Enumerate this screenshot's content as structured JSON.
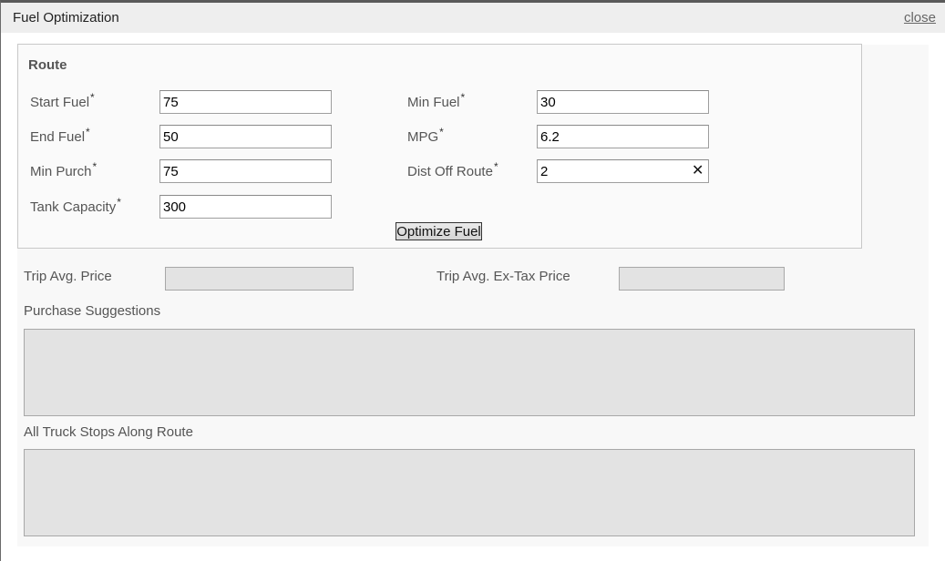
{
  "window": {
    "title": "Fuel Optimization",
    "close_label": "close"
  },
  "route": {
    "heading": "Route",
    "required_marker": "*",
    "fields": {
      "start_fuel": {
        "label": "Start Fuel",
        "value": "75"
      },
      "end_fuel": {
        "label": "End Fuel",
        "value": "50"
      },
      "min_purch": {
        "label": "Min Purch",
        "value": "75"
      },
      "tank_capacity": {
        "label": "Tank Capacity",
        "value": "300"
      },
      "min_fuel": {
        "label": "Min Fuel",
        "value": "30"
      },
      "mpg": {
        "label": "MPG",
        "value": "6.2"
      },
      "dist_off_route": {
        "label": "Dist Off Route",
        "value": "2",
        "clear_glyph": "✕"
      }
    },
    "optimize_button": "Optimize Fuel"
  },
  "results": {
    "trip_avg_price_label": "Trip Avg. Price",
    "trip_avg_price_value": "",
    "trip_avg_extax_label": "Trip Avg. Ex-Tax Price",
    "trip_avg_extax_value": "",
    "purchase_suggestions_label": "Purchase Suggestions",
    "all_truck_stops_label": "All Truck Stops Along Route"
  }
}
